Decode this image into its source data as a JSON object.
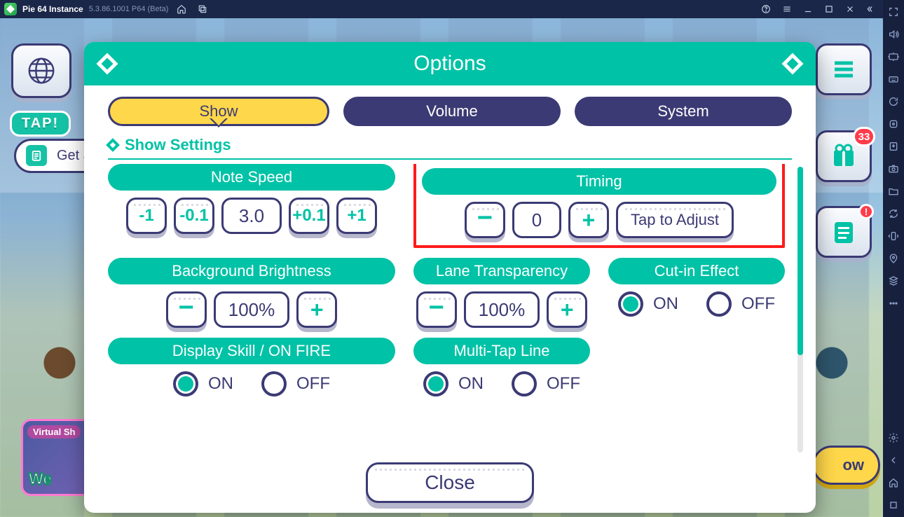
{
  "titlebar": {
    "title": "Pie 64 Instance",
    "version": "5.3.86.1001 P64 (Beta)"
  },
  "background": {
    "tap_label": "TAP!",
    "get_label": "Get a",
    "virtual_tag": "Virtual Sh",
    "welcome": "We",
    "gift_badge": "33",
    "list_alert": "!",
    "ow_label": "ow"
  },
  "modal": {
    "title": "Options",
    "tabs": {
      "show": "Show",
      "volume": "Volume",
      "system": "System"
    },
    "section_title": "Show Settings",
    "note_speed": {
      "header": "Note Speed",
      "minus1": "-1",
      "minus01": "-0.1",
      "value": "3.0",
      "plus01": "+0.1",
      "plus1": "+1"
    },
    "timing": {
      "header": "Timing",
      "value": "0",
      "tap_adjust": "Tap to Adjust"
    },
    "bg_brightness": {
      "header": "Background Brightness",
      "value": "100%"
    },
    "lane_transparency": {
      "header": "Lane Transparency",
      "value": "100%"
    },
    "cutin": {
      "header": "Cut-in Effect",
      "on": "ON",
      "off": "OFF"
    },
    "display_skill": {
      "header": "Display Skill / ON FIRE",
      "on": "ON",
      "off": "OFF"
    },
    "multitap": {
      "header": "Multi-Tap Line",
      "on": "ON",
      "off": "OFF"
    },
    "close": "Close"
  }
}
